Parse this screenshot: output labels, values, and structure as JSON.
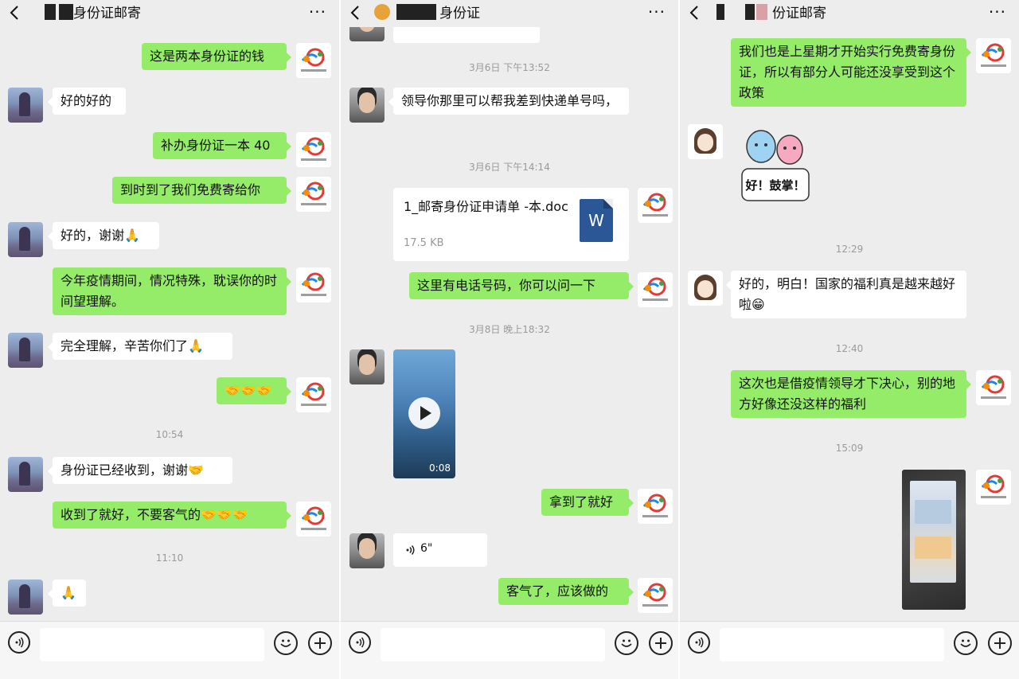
{
  "panes": [
    {
      "title": "身份证邮寄",
      "messages": [
        {
          "text": "这是两本身份证的钱"
        },
        {
          "text": "好的好的"
        },
        {
          "text": "补办身份证一本 40"
        },
        {
          "text": "到时到了我们免费寄给你"
        },
        {
          "text": "好的，谢谢🙏"
        },
        {
          "text": "今年疫情期间，情况特殊，耽误你的时间望理解。"
        },
        {
          "text": "完全理解，辛苦你们了🙏"
        },
        {
          "text": "🤝🤝🤝"
        },
        {
          "time": "10:54"
        },
        {
          "text": "身份证已经收到，谢谢🤝"
        },
        {
          "text": "收到了就好，不要客气的🤝🤝🤝"
        },
        {
          "time": "11:10"
        },
        {
          "text": "🙏"
        }
      ]
    },
    {
      "title": "身份证",
      "messages": [
        {
          "time": "3月6日 下午13:52"
        },
        {
          "text": "领导你那里可以帮我差到快递单号吗，"
        },
        {
          "time": "3月6日 下午14:14"
        },
        {
          "file_name": "1_邮寄身份证申请单 -本.doc",
          "file_size": "17.5 KB",
          "file_icon": "W"
        },
        {
          "text": "这里有电话号码，你可以问一下"
        },
        {
          "time": "3月8日 晚上18:32"
        },
        {
          "video_duration": "0:08"
        },
        {
          "text": "拿到了就好"
        },
        {
          "voice_length": "6\""
        },
        {
          "text": "客气了，应该做的"
        }
      ]
    },
    {
      "title": "份证邮寄",
      "messages": [
        {
          "text": "我们也是上星期才开始实行免费寄身份证，所以有部分人可能还没享受到这个政策"
        },
        {
          "sticker_text": "好！鼓掌！"
        },
        {
          "time": "12:29"
        },
        {
          "text": "好的，明白！国家的福利真是越来越好啦😁"
        },
        {
          "time": "12:40"
        },
        {
          "text": "这次也是借疫情领导才下决心，别的地方好像还没这样的福利"
        },
        {
          "time": "15:09"
        }
      ]
    }
  ],
  "colors": {
    "chat_background": "#ededed",
    "my_bubble": "#95ec69",
    "their_bubble": "#ffffff",
    "timestamp": "#9a9a9a",
    "word_icon": "#2b5797"
  },
  "icons": {
    "back": "chevron-left-icon",
    "more": "more-dots-icon",
    "voice": "voice-icon",
    "emoji": "emoji-icon",
    "plus": "plus-icon"
  }
}
